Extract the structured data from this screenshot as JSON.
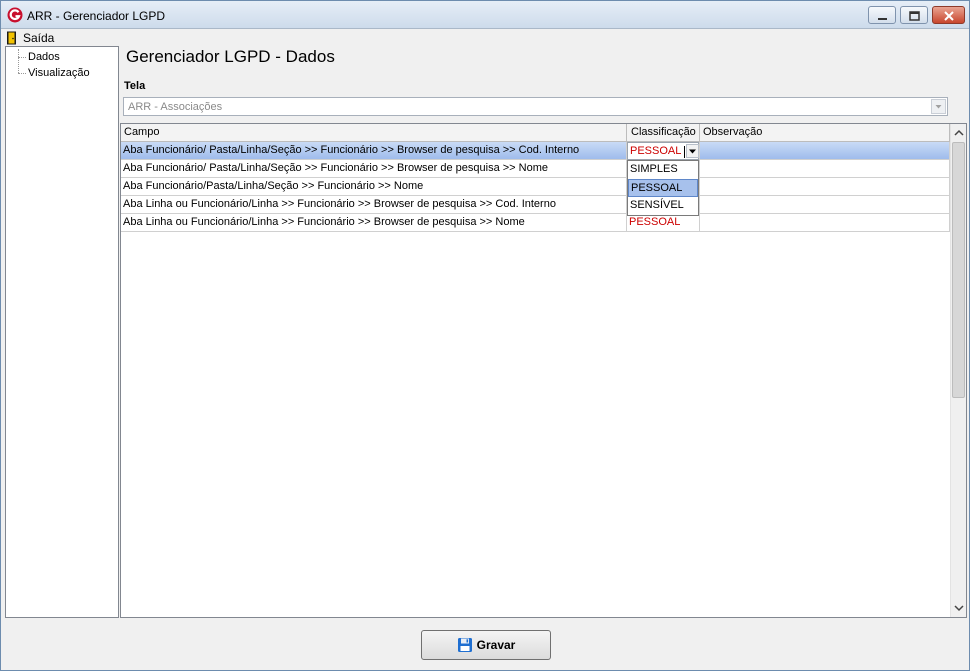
{
  "window": {
    "title": "ARR - Gerenciador LGPD"
  },
  "menu": {
    "exit_label": "Saída"
  },
  "tree": {
    "items": [
      {
        "label": "Dados"
      },
      {
        "label": "Visualização"
      }
    ]
  },
  "page": {
    "title": "Gerenciador LGPD - Dados",
    "tela_label": "Tela",
    "tela_value": "ARR - Associações"
  },
  "grid": {
    "columns": [
      "Campo",
      "Classificação",
      "Observação"
    ],
    "rows": [
      {
        "campo": "Aba Funcionário/ Pasta/Linha/Seção >> Funcionário >> Browser de pesquisa >> Cod. Interno",
        "classificacao": "PESSOAL",
        "observacao": ""
      },
      {
        "campo": "Aba Funcionário/ Pasta/Linha/Seção >> Funcionário >> Browser de pesquisa >> Nome",
        "classificacao": "",
        "observacao": ""
      },
      {
        "campo": "Aba Funcionário/Pasta/Linha/Seção >> Funcionário >> Nome",
        "classificacao": "",
        "observacao": ""
      },
      {
        "campo": "Aba Linha ou Funcionário/Linha >> Funcionário >> Browser de pesquisa >> Cod. Interno",
        "classificacao": "",
        "observacao": ""
      },
      {
        "campo": "Aba Linha ou Funcionário/Linha >> Funcionário >> Browser de pesquisa >> Nome",
        "classificacao": "PESSOAL",
        "observacao": ""
      }
    ],
    "editor_value": "PESSOAL",
    "dropdown_options": [
      "SIMPLES",
      "PESSOAL",
      "SENSÍVEL"
    ],
    "dropdown_highlighted": "PESSOAL"
  },
  "actions": {
    "save_label": "Gravar"
  },
  "colors": {
    "selected_row": "#9fbcec",
    "sensitive_text": "#cc0000",
    "title_bar": "#cddbeb"
  }
}
